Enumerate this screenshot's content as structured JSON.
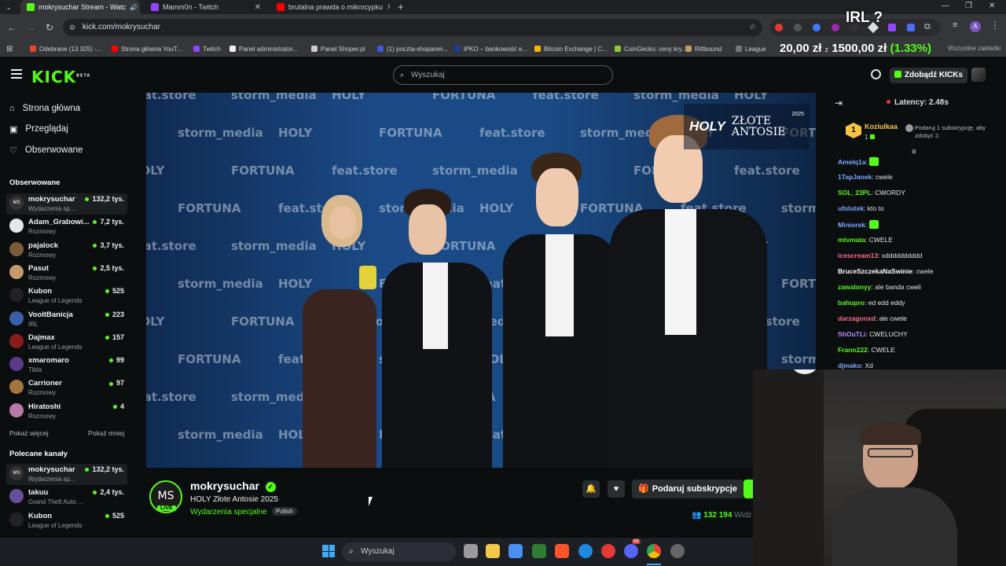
{
  "browser": {
    "tabs": [
      {
        "title": "mokrysuchar Stream - Watc",
        "color": "#53fc18",
        "active": true
      },
      {
        "title": "Mamm0n - Twitch",
        "color": "#9146ff",
        "active": false
      },
      {
        "title": "brutalna prawda o mikrocypku",
        "color": "#ff0000",
        "active": false
      }
    ],
    "new_tab": "+",
    "url": "kick.com/mokrysuchar",
    "bookmarks": [
      {
        "label": "Odebrane (13 325) -...",
        "color": "#ea4335"
      },
      {
        "label": "Strona główna YouT...",
        "color": "#ff0000"
      },
      {
        "label": "Twitch",
        "color": "#9146ff"
      },
      {
        "label": "Panel administrator...",
        "color": "#eeeeee"
      },
      {
        "label": "Panel Shoper.pl",
        "color": "#cccccc"
      },
      {
        "label": "(1) poczta-shoparen...",
        "color": "#3b5bdb"
      },
      {
        "label": "iPKO – bankowość e...",
        "color": "#1c3f94"
      },
      {
        "label": "Bitcoin Exchange | C...",
        "color": "#f0b90b"
      },
      {
        "label": "CoinGecko: ceny kry...",
        "color": "#8dc63f"
      },
      {
        "label": "Riftbound",
        "color": "#c0a060"
      },
      {
        "label": "League",
        "color": "#777777"
      }
    ],
    "bookmarks_right": "Wszystkie zakładki",
    "overlay_irl": "IRL ?",
    "overlay_ticker_a": "20,00 zł",
    "overlay_ticker_b": "1500,00 zł",
    "overlay_ticker_pct": "(1.33%)"
  },
  "kick": {
    "logo": "KICK",
    "logo_beta": "BETA",
    "search_placeholder": "Wyszukaj",
    "get_kicks": "Zdobądź KICKs",
    "nav": [
      {
        "label": "Strona główna"
      },
      {
        "label": "Przeglądaj"
      },
      {
        "label": "Obserwowane"
      }
    ],
    "followed_title": "Obserwowane",
    "followed": [
      {
        "initials": "MS",
        "name": "mokrysuchar",
        "category": "Wydarzenia sp...",
        "viewers": "132,2 tys.",
        "color": "#333333"
      },
      {
        "initials": "",
        "name": "Adam_Grabowi...",
        "category": "Rozmowy",
        "viewers": "7,2 tys.",
        "color": "#e6e6e6"
      },
      {
        "initials": "",
        "name": "pajalock",
        "category": "Rozmowy",
        "viewers": "3,7 tys.",
        "color": "#7a5c3a"
      },
      {
        "initials": "",
        "name": "Pasut",
        "category": "Rozmowy",
        "viewers": "2,5 tys.",
        "color": "#c49a6c"
      },
      {
        "initials": "",
        "name": "Kubon",
        "category": "League of Legends",
        "viewers": "525",
        "color": "#222222"
      },
      {
        "initials": "",
        "name": "VooltBanicja",
        "category": "IRL",
        "viewers": "223",
        "color": "#3d5fa8"
      },
      {
        "initials": "",
        "name": "Dajmax",
        "category": "League of Legends",
        "viewers": "157",
        "color": "#8b1c1c"
      },
      {
        "initials": "",
        "name": "xmaromaro",
        "category": "Tibia",
        "viewers": "99",
        "color": "#5a3b8a"
      },
      {
        "initials": "",
        "name": "Carrioner",
        "category": "Rozmowy",
        "viewers": "97",
        "color": "#a5743a"
      },
      {
        "initials": "",
        "name": "Hiratoshi",
        "category": "Rozmowy",
        "viewers": "4",
        "color": "#b77aa8"
      }
    ],
    "show_more": "Pokaż więcej",
    "show_less": "Pokaż mniej",
    "recommended_title": "Polecane kanały",
    "recommended": [
      {
        "initials": "MS",
        "name": "mokrysuchar",
        "category": "Wydarzenia sp...",
        "viewers": "132,2 tys.",
        "color": "#333333"
      },
      {
        "initials": "",
        "name": "takuu",
        "category": "Grand Theft Auto ...",
        "viewers": "2,4 tys.",
        "color": "#6a4d9a"
      },
      {
        "initials": "",
        "name": "Kubon",
        "category": "League of Legends",
        "viewers": "525",
        "color": "#222222"
      }
    ],
    "stream": {
      "streamer_initials": "MS",
      "live": "LIVE",
      "name": "mokrysuchar",
      "title": "HOLY Złote Antosie 2025",
      "category": "Wydarzenia specjalne",
      "language": "Polish",
      "viewers": "132 194",
      "viewers_label": "Widz",
      "subscribe_label": "Podaruj subskrypcje"
    },
    "video_overlay": {
      "brand": "HOLY",
      "event_line1": "ZŁOTE",
      "event_line2": "ANTOSIE",
      "year": "2025"
    },
    "chat": {
      "latency": "Latency: 2.48s",
      "gift_user": "Koziulkaa",
      "gift_count": "1",
      "gift_rank": "1",
      "gift_text": "Podaruj 1 subskrypcję, aby zdobyć 2.",
      "messages": [
        {
          "user": "Amelq1a",
          "text": "",
          "color": "#7ea6ff"
        },
        {
          "user": "1TapJanek",
          "text": "cwele",
          "color": "#7ea6ff"
        },
        {
          "user": "SOL_23PL",
          "text": "CWORDY",
          "color": "#53fc18"
        },
        {
          "user": "ufolutek",
          "text": "kto to",
          "color": "#7ea6ff"
        },
        {
          "user": "Miniorek",
          "text": "",
          "color": "#7ea6ff"
        },
        {
          "user": "mtvmata",
          "text": "CWELE",
          "color": "#53fc18"
        },
        {
          "user": "icescream13",
          "text": "xdddddddddd",
          "color": "#ff6b8a"
        },
        {
          "user": "BruceSzczekaNaSwinie",
          "text": "cwele",
          "color": "#ffffff"
        },
        {
          "user": "zawalonyy",
          "text": "ale banda cweli",
          "color": "#53fc18"
        },
        {
          "user": "bahupro",
          "text": "ed edd eddy",
          "color": "#53fc18"
        },
        {
          "user": "darzagonxd",
          "text": "ale cwele",
          "color": "#ff6b8a"
        },
        {
          "user": "ShOuTLi",
          "text": "CWELUCHY",
          "color": "#b388ff"
        },
        {
          "user": "Frano222",
          "text": "CWELE",
          "color": "#53fc18"
        },
        {
          "user": "djmako",
          "text": "Xd",
          "color": "#7ea6ff"
        }
      ]
    }
  },
  "taskbar": {
    "search_placeholder": "Wyszukaj",
    "badge": "99"
  }
}
